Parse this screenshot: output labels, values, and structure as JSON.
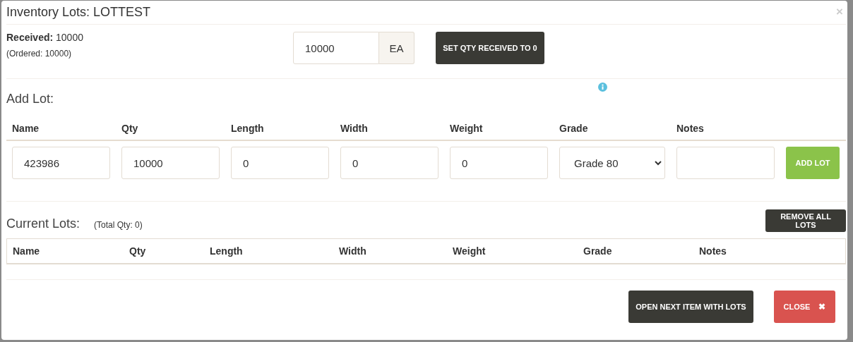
{
  "modal": {
    "title": "Inventory Lots: LOTTEST",
    "close_symbol": "×"
  },
  "received": {
    "label": "Received:",
    "value": "10000",
    "ordered": "(Ordered: 10000)",
    "qty_value": "10000",
    "unit": "EA",
    "set_button": "SET QTY RECEIVED TO 0"
  },
  "add_lot": {
    "heading": "Add Lot:",
    "columns": [
      "Name",
      "Qty",
      "Length",
      "Width",
      "Weight",
      "Grade",
      "Notes"
    ],
    "fields": [
      {
        "kind": "input",
        "value": "423986"
      },
      {
        "kind": "input",
        "value": "10000"
      },
      {
        "kind": "input",
        "value": "0"
      },
      {
        "kind": "input",
        "value": "0"
      },
      {
        "kind": "input",
        "value": "0"
      },
      {
        "kind": "select",
        "value": "Grade 80"
      },
      {
        "kind": "input"
      }
    ],
    "add_button": "ADD LOT"
  },
  "current_lots": {
    "heading": "Current Lots:",
    "total": "(Total Qty: 0)",
    "remove_button": "REMOVE ALL LOTS",
    "columns": [
      "Name",
      "Qty",
      "Length",
      "Width",
      "Weight",
      "Grade",
      "Notes"
    ]
  },
  "footer": {
    "buttons": [
      {
        "kind": "dark",
        "label": "OPEN NEXT ITEM WITH LOTS"
      },
      {
        "kind": "danger",
        "label": "CLOSE",
        "icon": "✖"
      }
    ]
  }
}
